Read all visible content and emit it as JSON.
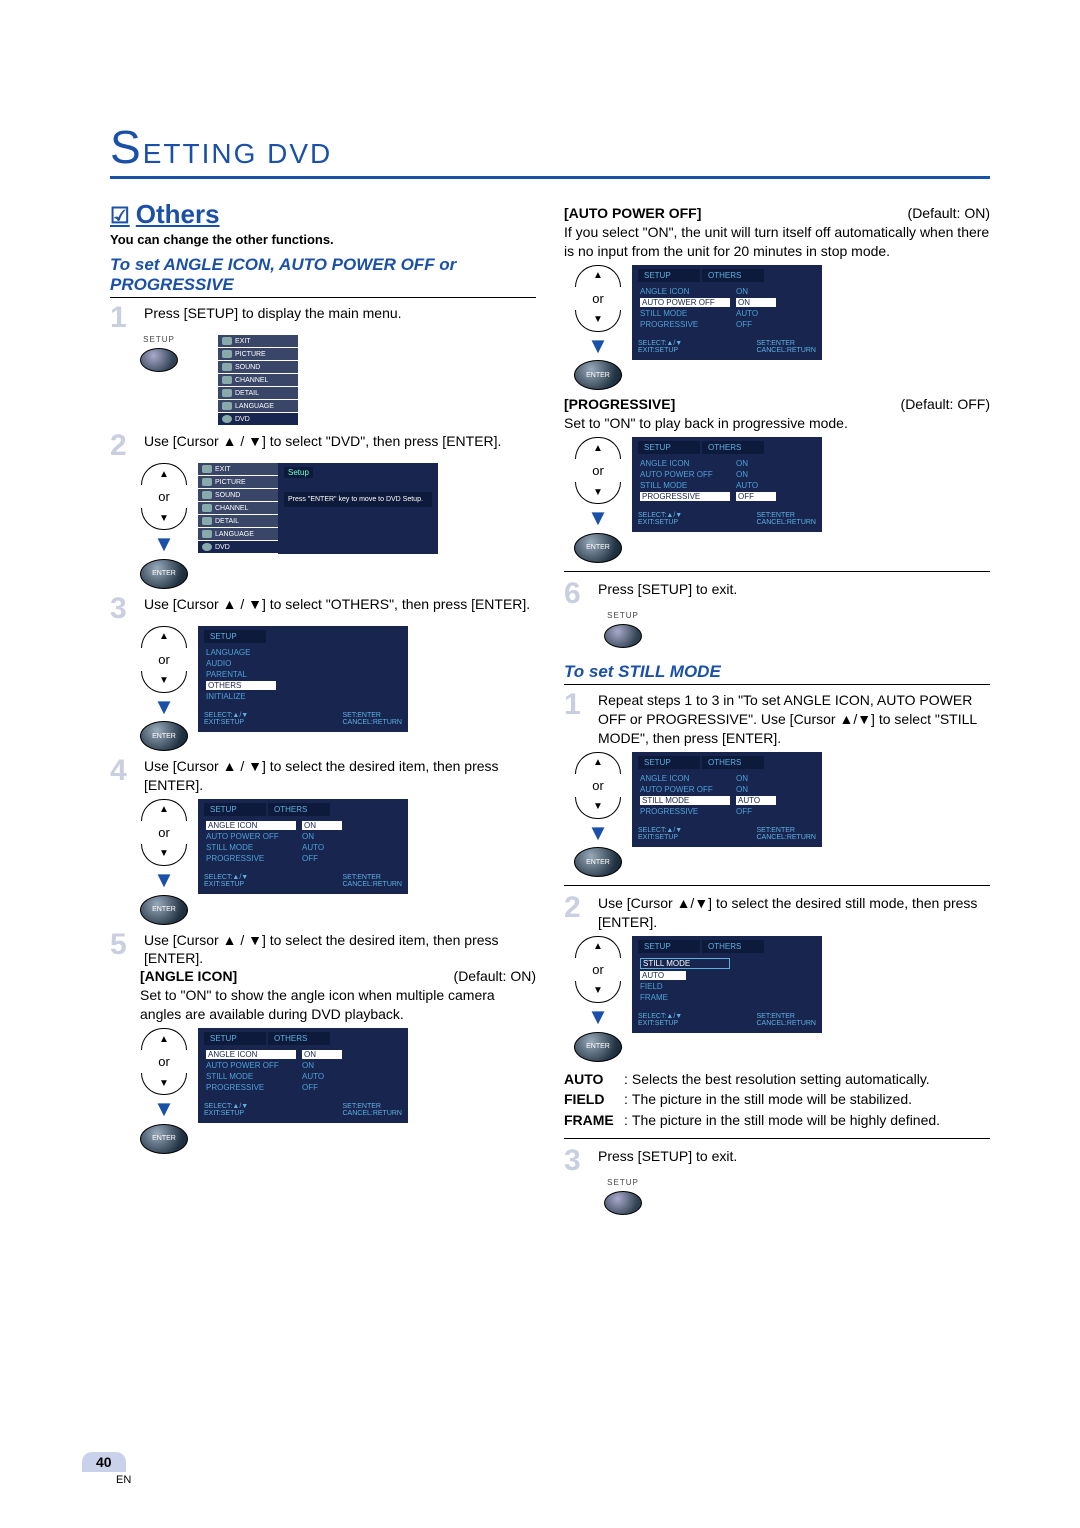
{
  "chapter": {
    "letter": "S",
    "rest": "ETTING   DVD"
  },
  "section": {
    "check": "☑",
    "title": "Others",
    "blurb": "You can change the other functions."
  },
  "subheadA": "To set ANGLE ICON, AUTO POWER OFF or PROGRESSIVE",
  "subheadB": "To set STILL MODE",
  "steps": {
    "l1": "Press [SETUP] to display the main menu.",
    "l2": "Use [Cursor ▲ / ▼] to select \"DVD\", then press [ENTER].",
    "l3": "Use [Cursor ▲ / ▼] to select \"OTHERS\", then press [ENTER].",
    "l4": "Use [Cursor ▲ / ▼] to select the desired item, then press [ENTER].",
    "l5": "Use [Cursor ▲ / ▼] to select the desired item, then press [ENTER].",
    "l6": "Press [SETUP] to exit.",
    "r1": "Repeat steps 1 to 3 in \"To set ANGLE ICON, AUTO POWER OFF or PROGRESSIVE\". Use [Cursor ▲/▼] to select \"STILL MODE\", then press [ENTER].",
    "r2": "Use [Cursor ▲/▼] to select the desired still mode, then press [ENTER].",
    "r3": "Press [SETUP] to exit."
  },
  "angle": {
    "name": "[ANGLE ICON]",
    "default": "(Default: ON)",
    "desc": "Set to \"ON\" to show the angle icon when multiple camera angles are available during DVD playback."
  },
  "auto": {
    "name": "[AUTO POWER OFF]",
    "default": "(Default: ON)",
    "desc": "If you select \"ON\", the unit will turn itself off automatically when there is no input from the unit for 20 minutes in stop mode."
  },
  "prog": {
    "name": "[PROGRESSIVE]",
    "default": "(Default: OFF)",
    "desc": "Set to \"ON\" to play back in progressive mode."
  },
  "defs": {
    "auto_t": "AUTO",
    "auto_d": "Selects the best resolution setting automatically.",
    "field_t": "FIELD",
    "field_d": "The picture in the still mode will be stabilized.",
    "frame_t": "FRAME",
    "frame_d": "The picture in the still mode will be highly defined."
  },
  "labels": {
    "or": "or",
    "enter": "ENTER",
    "setup": "SETUP"
  },
  "osd": {
    "tab_setup": "SETUP",
    "tab_others": "OTHERS",
    "angle_icon": "ANGLE ICON",
    "auto_power_off": "AUTO POWER OFF",
    "still_mode_k": "STILL MODE",
    "progressive": "PROGRESSIVE",
    "v_on": "ON",
    "v_auto": "AUTO",
    "v_off": "OFF",
    "foot_sel": "SELECT:▲/▼",
    "foot_exit": "EXIT:SETUP",
    "foot_set": "SET:ENTER",
    "foot_cancel": "CANCEL:RETURN",
    "lang": "LANGUAGE",
    "audio": "AUDIO",
    "parental": "PARENTAL",
    "others": "OTHERS",
    "init": "INITIALIZE",
    "still_mode_title": "STILL MODE",
    "opt_auto": "AUTO",
    "opt_field": "FIELD",
    "opt_frame": "FRAME",
    "setup_tab_setup": "Setup",
    "setup_hint": "Press \"ENTER\" key to move to DVD Setup.",
    "m_exit": "EXIT",
    "m_picture": "PICTURE",
    "m_sound": "SOUND",
    "m_channel": "CHANNEL",
    "m_detail": "DETAIL",
    "m_language": "LANGUAGE",
    "m_dvd": "DVD"
  },
  "page": {
    "num": "40",
    "lang": "EN"
  }
}
